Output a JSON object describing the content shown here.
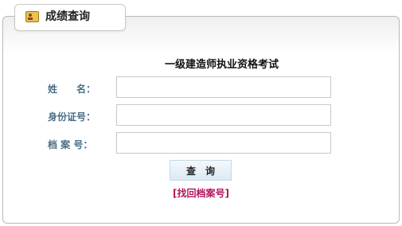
{
  "tab": {
    "title": "成绩查询",
    "icon": "id-card-icon"
  },
  "form": {
    "exam_title": "一级建造师执业资格考试",
    "name_label": "姓　　名：",
    "id_label": "身份证号：",
    "archive_label": "档 案 号：",
    "name_value": "",
    "id_value": "",
    "archive_value": ""
  },
  "actions": {
    "query_label": "查　询",
    "recover_link": "[找回档案号]"
  },
  "colors": {
    "label": "#4a6f87",
    "link": "#b3155b",
    "panel_border": "#b9b9b9"
  }
}
